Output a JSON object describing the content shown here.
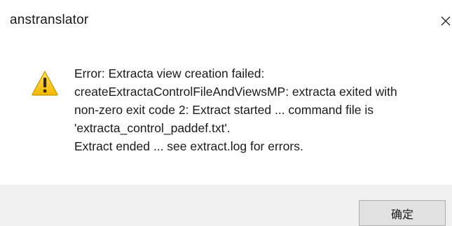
{
  "window": {
    "title": "anstranslator",
    "close_icon": "close-icon"
  },
  "message": {
    "icon": "warning-icon",
    "lines": [
      "Error: Extracta view creation failed:",
      "createExtractaControlFileAndViewsMP: extracta exited with",
      "non-zero exit code 2: Extract started ... command file is",
      "'extracta_control_paddef.txt'.",
      "Extract ended ... see extract.log for errors."
    ]
  },
  "buttons": {
    "ok_label": "确定"
  },
  "colors": {
    "footer_bg": "#f0f0f0",
    "warning_fill": "#f5c400",
    "warning_mark": "#3a2a00"
  }
}
